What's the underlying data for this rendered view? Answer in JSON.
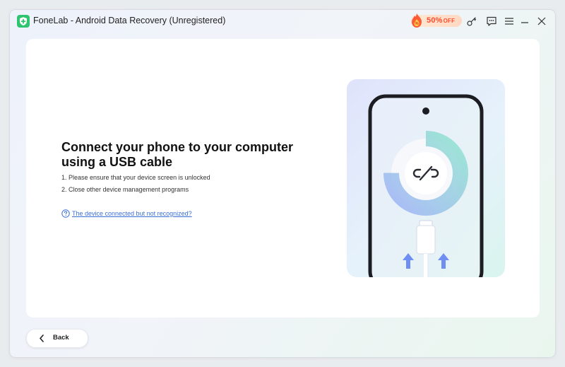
{
  "window": {
    "title": "FoneLab - Android Data Recovery (Unregistered)",
    "promo": {
      "label": "50%",
      "suffix": "OFF"
    },
    "controls": [
      "key-icon",
      "feedback-icon",
      "menu-icon",
      "minimize-icon",
      "close-icon"
    ]
  },
  "main": {
    "heading": "Connect your phone to your computer using a USB cable",
    "steps": [
      "1. Please ensure that your device screen is unlocked",
      "2. Close other device management programs"
    ],
    "help_link": "The device connected but not recognized?"
  },
  "footer": {
    "back_label": "Back"
  },
  "colors": {
    "accent": "#3a6fd8",
    "promo_text": "#ff4b2b",
    "logo": "#2fc46f",
    "arrows": "#6f8ef2"
  }
}
